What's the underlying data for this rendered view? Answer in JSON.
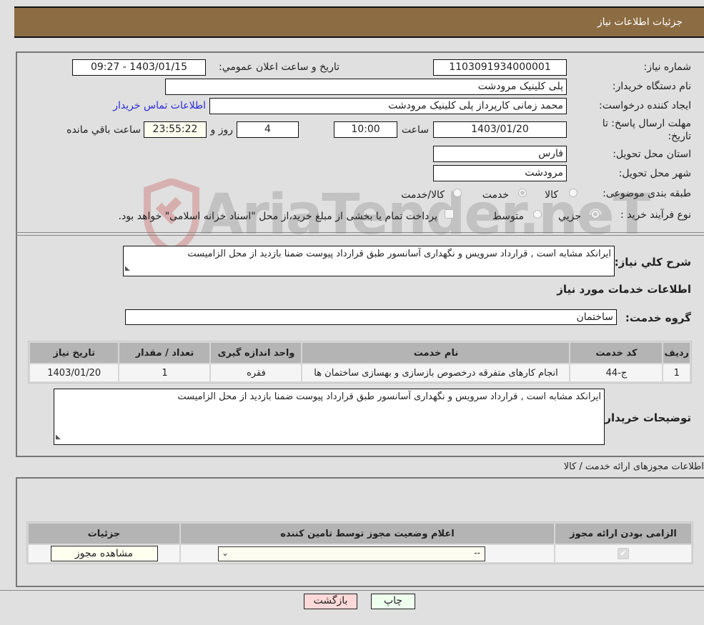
{
  "header": {
    "title": "جزئیات اطلاعات نیاز"
  },
  "form": {
    "need_number_label": "شماره نیاز:",
    "need_number": "1103091934000001",
    "announce_label": "تاريخ و ساعت اعلان عمومي:",
    "announce_value": "1403/01/15 - 09:27",
    "buyer_org_label": "نام دستگاه خریدار:",
    "buyer_org": "پلی کلینیک مرودشت",
    "creator_label": "ایجاد کننده درخواست:",
    "creator": "محمد  زمانی کارپرداز پلی کلینیک مرودشت",
    "buyer_contact_link": "اطلاعات تماس خریدار",
    "deadline_label_1": "مهلت ارسال پاسخ: تا",
    "deadline_label_2": "تاریخ:",
    "deadline_date": "1403/01/20",
    "time_label": "ساعت",
    "deadline_time": "10:00",
    "days_value": "4",
    "days_label": "روز و",
    "remaining_time": "23:55:22",
    "remaining_label": "ساعت باقي مانده",
    "province_label": "استان محل تحویل:",
    "province": "فارس",
    "city_label": "شهر محل تحویل:",
    "city": "مرودشت",
    "category_label": "طبقه بندی موضوعی:",
    "category_options": [
      {
        "label": "کالا",
        "selected": false
      },
      {
        "label": "خدمت",
        "selected": true
      },
      {
        "label": "کالا/خدمت",
        "selected": false
      }
    ],
    "process_label": "نوع فرآیند خرید :",
    "process_options": [
      {
        "label": "جزيي",
        "selected": true
      },
      {
        "label": "متوسط",
        "selected": false
      }
    ],
    "treasury_note": "پرداخت تمام یا بخشی از مبلغ خرید،از محل \"اسناد خزانه اسلامی\" خواهد بود.",
    "treasury_checked": false
  },
  "description": {
    "label": "شرح کلي نیاز:",
    "value": "ایرانکد مشابه است , قرارداد سرویس و نگهداری آسانسور طبق قرارداد پیوست ضمنا بازدید از محل الزامیست"
  },
  "services": {
    "section_title": "اطلاعات خدمات مورد نیاز",
    "group_label": "گروه خدمت:",
    "group_value": "ساختمان",
    "columns": [
      "ردیف",
      "کد خدمت",
      "نام خدمت",
      "واحد اندازه گیری",
      "تعداد / مقدار",
      "تاریخ نیاز"
    ],
    "rows": [
      [
        "1",
        "ج-44",
        "انجام کارهای متفرقه درخصوص بازسازی و بهسازی ساختمان ها",
        "فقره",
        "1",
        "1403/01/20"
      ]
    ]
  },
  "buyer_notes": {
    "label": "توضیحات خریدار:",
    "value": "ایرانکد مشابه است , قرارداد سرویس و نگهداری آسانسور طبق قرارداد پیوست ضمنا بازدید از محل الزامیست"
  },
  "licenses": {
    "section_title": "اطلاعات مجوزهای ارائه خدمت / کالا",
    "columns": [
      "الزامی بودن ارائه مجوز",
      "اعلام وضعیت مجوز توسط تامین کننده",
      "جزئیات"
    ],
    "rows": [
      {
        "required_checked": true,
        "status_select": "--",
        "details_button": "مشاهده مجوز"
      }
    ]
  },
  "footer": {
    "print_button": "چاپ",
    "back_button": "بازگشت"
  },
  "colors": {
    "header_bg": "#8c6c42",
    "print_bg": "#eeffee",
    "back_bg": "#ffd9d9",
    "highlight_bg": "#fffff0",
    "link": "#2a2ad6"
  },
  "watermark": {
    "text": "AriaTender.neT"
  }
}
